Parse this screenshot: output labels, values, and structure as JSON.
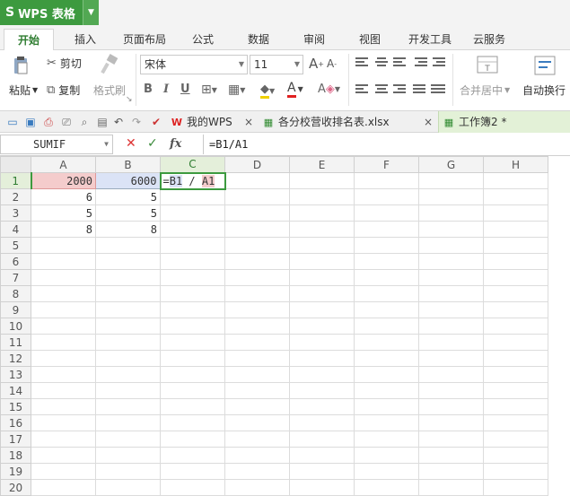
{
  "app": {
    "name": "WPS 表格",
    "logo": "S"
  },
  "ribbon_tabs": [
    "开始",
    "插入",
    "页面布局",
    "公式",
    "数据",
    "审阅",
    "视图",
    "开发工具",
    "云服务"
  ],
  "ribbon": {
    "cut": "剪切",
    "paste": "粘贴",
    "copy": "复制",
    "format_painter": "格式刷",
    "font_name": "宋体",
    "font_size": "11",
    "merge_center": "合并居中",
    "wrap_text": "自动换行"
  },
  "doc_tabs": [
    {
      "label": "我的WPS",
      "close": "×"
    },
    {
      "label": "各分校营收排名表.xlsx",
      "close": "×"
    },
    {
      "label": "工作簿2 *",
      "close": ""
    }
  ],
  "formula_bar": {
    "name_box": "SUMIF",
    "cancel": "✕",
    "confirm": "✓",
    "fx": "fx",
    "formula": "=B1/A1"
  },
  "sheet": {
    "columns": [
      "A",
      "B",
      "C",
      "D",
      "E",
      "F",
      "G",
      "H"
    ],
    "rows": [
      "1",
      "2",
      "3",
      "4",
      "5",
      "6",
      "7",
      "8",
      "9",
      "10",
      "11",
      "12",
      "13",
      "14",
      "15",
      "16",
      "17",
      "18",
      "19",
      "20"
    ],
    "cells": {
      "A1": "2000",
      "B1": "6000",
      "A2": "6",
      "B2": "5",
      "A3": "5",
      "B3": "5",
      "A4": "8",
      "B4": "8"
    },
    "edit_cell": {
      "eq": "=",
      "ref1": "B1",
      "op": " / ",
      "ref2": "A1"
    }
  }
}
